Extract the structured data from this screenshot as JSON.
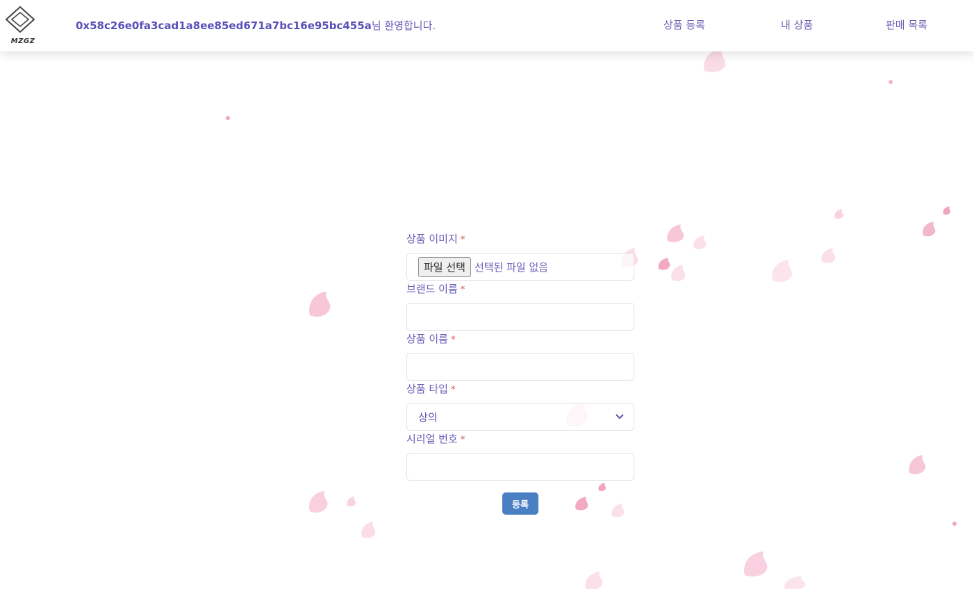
{
  "header": {
    "logo_text": "MZGZ",
    "wallet_address": "0x58c26e0fa3cad1a8ee85ed671a7bc16e95bc455a",
    "welcome_suffix": "님 환영합니다.",
    "nav": {
      "register": "상품 등록",
      "my_products": "내 상품",
      "sales_list": "판매 목록"
    }
  },
  "form": {
    "image_label": "상품 이미지",
    "file_button": "파일 선택",
    "file_status": "선택된 파일 없음",
    "brand_label": "브랜드 이름",
    "brand_value": "",
    "name_label": "상품 이름",
    "name_value": "",
    "type_label": "상품 타입",
    "type_value": "상의",
    "serial_label": "시리얼 번호",
    "serial_value": "",
    "required_mark": "*",
    "submit_label": "등록"
  },
  "colors": {
    "accent": "#4a7fc4",
    "text": "#6a5fb8",
    "required": "#d9534f",
    "petal": "#f7c7d8"
  }
}
